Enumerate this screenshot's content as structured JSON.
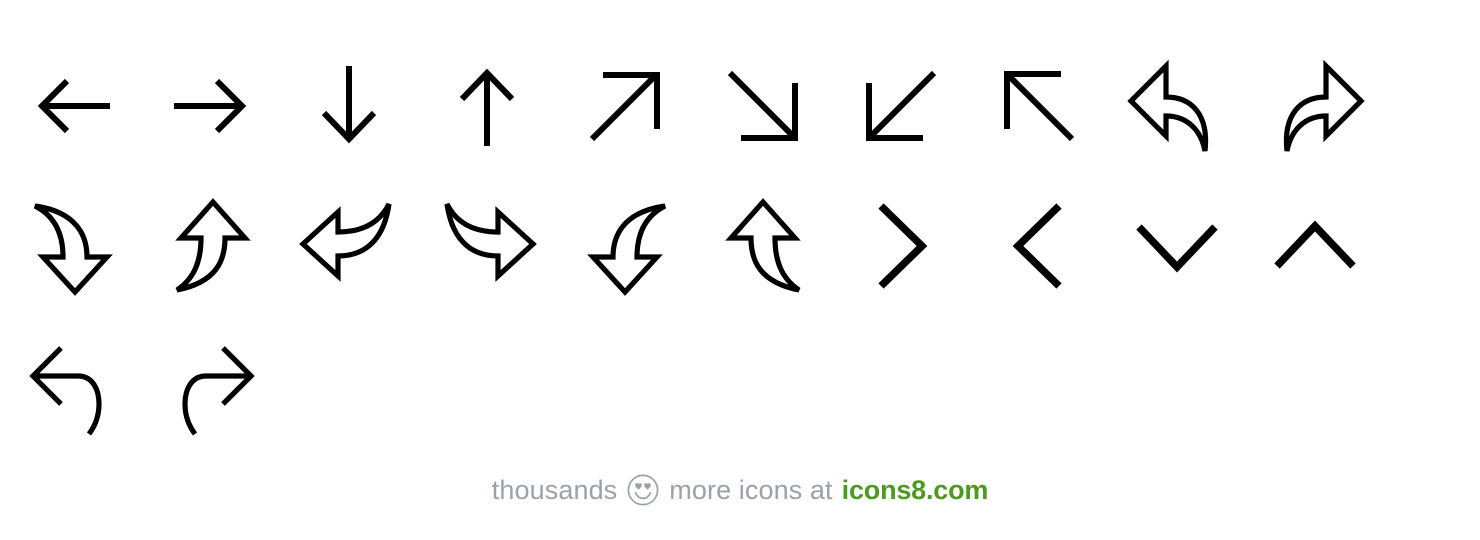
{
  "page": {
    "background_color": "#ffffff",
    "stroke_color": "#000000",
    "title": "Arrows icon set"
  },
  "icon_grid": {
    "columns": 10,
    "rows": [
      {
        "row_index": 1,
        "icons": [
          {
            "name": "arrow-left-icon",
            "label": "Left Arrow",
            "style": "line"
          },
          {
            "name": "arrow-right-icon",
            "label": "Right Arrow",
            "style": "line"
          },
          {
            "name": "arrow-down-icon",
            "label": "Down Arrow",
            "style": "line"
          },
          {
            "name": "arrow-up-icon",
            "label": "Up Arrow",
            "style": "line"
          },
          {
            "name": "arrow-up-right-icon",
            "label": "Up Right Arrow",
            "style": "line"
          },
          {
            "name": "arrow-down-right-icon",
            "label": "Down Right Arrow",
            "style": "line"
          },
          {
            "name": "arrow-down-left-icon",
            "label": "Down Left Arrow",
            "style": "line"
          },
          {
            "name": "arrow-up-left-icon",
            "label": "Up Left Arrow",
            "style": "line"
          },
          {
            "name": "undo-arrow-icon",
            "label": "Undo",
            "style": "outline-curved"
          },
          {
            "name": "redo-arrow-icon",
            "label": "Redo",
            "style": "outline-curved"
          }
        ]
      },
      {
        "row_index": 2,
        "icons": [
          {
            "name": "curved-arrow-down-icon",
            "label": "Curved Down Arrow",
            "style": "outline-curved"
          },
          {
            "name": "curved-arrow-up-icon",
            "label": "Curved Up Arrow",
            "style": "outline-curved"
          },
          {
            "name": "curved-arrow-left-icon",
            "label": "Curved Left Arrow",
            "style": "outline-curved"
          },
          {
            "name": "curved-arrow-right-icon",
            "label": "Curved Right Arrow",
            "style": "outline-curved"
          },
          {
            "name": "curved-arrow-down-left-icon",
            "label": "Curved Down Left Arrow",
            "style": "outline-curved"
          },
          {
            "name": "curved-arrow-up-right-icon",
            "label": "Curved Up Right Arrow",
            "style": "outline-curved"
          },
          {
            "name": "chevron-right-icon",
            "label": "Chevron Right",
            "style": "chevron"
          },
          {
            "name": "chevron-left-icon",
            "label": "Chevron Left",
            "style": "chevron"
          },
          {
            "name": "chevron-down-icon",
            "label": "Chevron Down",
            "style": "chevron"
          },
          {
            "name": "chevron-up-icon",
            "label": "Chevron Up",
            "style": "chevron"
          }
        ]
      },
      {
        "row_index": 3,
        "icons": [
          {
            "name": "return-arrow-left-icon",
            "label": "Return Left Arrow",
            "style": "line-curved"
          },
          {
            "name": "return-arrow-right-icon",
            "label": "Return Right Arrow",
            "style": "line-curved"
          }
        ]
      }
    ]
  },
  "footer": {
    "prefix_text": "thousands",
    "smiley_icon": "smiley-heart-eyes-icon",
    "middle_text": "more icons at",
    "brand_text": "icons8.com",
    "text_color": "#9aa1a8",
    "brand_color": "#4e9a20"
  }
}
